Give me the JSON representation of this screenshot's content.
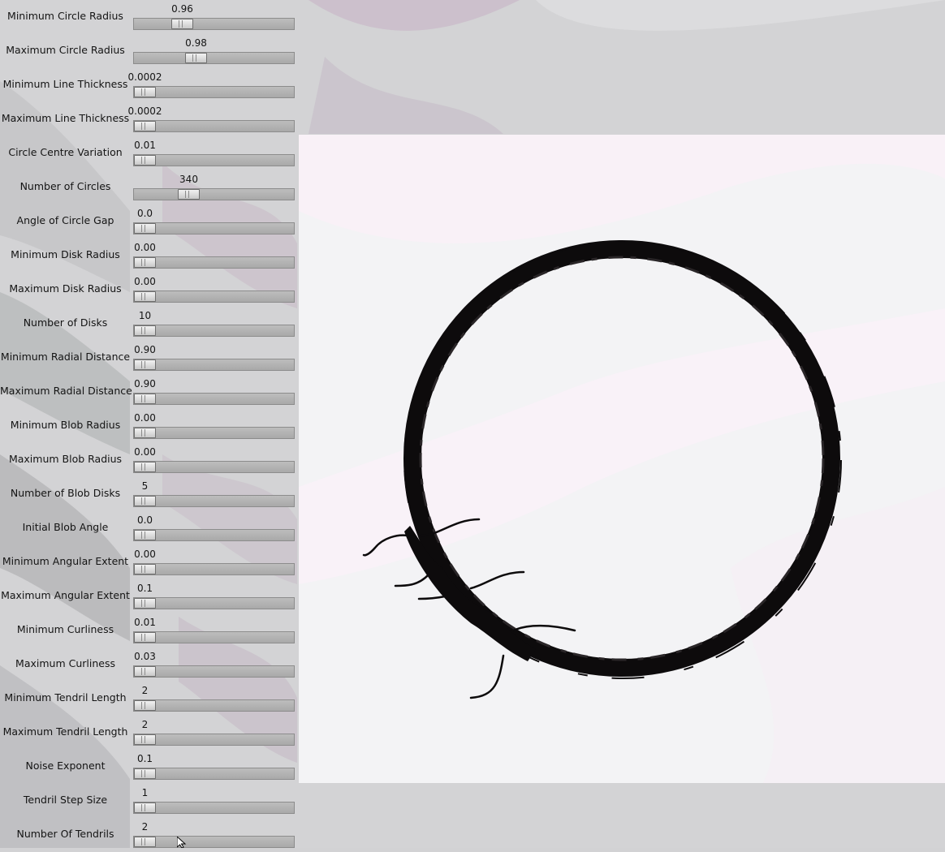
{
  "sliders": [
    {
      "label": "Minimum Circle Radius",
      "value": "0.96",
      "fraction": 0.27
    },
    {
      "label": "Maximum Circle Radius",
      "value": "0.98",
      "fraction": 0.37
    },
    {
      "label": "Minimum Line Thickness",
      "value": "0.0002",
      "fraction": 0.0
    },
    {
      "label": "Maximum Line Thickness",
      "value": "0.0002",
      "fraction": 0.0
    },
    {
      "label": "Circle Centre Variation",
      "value": "0.01",
      "fraction": 0.0
    },
    {
      "label": "Number of Circles",
      "value": "340",
      "fraction": 0.32
    },
    {
      "label": "Angle of Circle Gap",
      "value": "0.0",
      "fraction": 0.0
    },
    {
      "label": "Minimum Disk Radius",
      "value": "0.00",
      "fraction": 0.0
    },
    {
      "label": "Maximum Disk Radius",
      "value": "0.00",
      "fraction": 0.0
    },
    {
      "label": "Number of Disks",
      "value": "10",
      "fraction": 0.0
    },
    {
      "label": "Minimum Radial Distance",
      "value": "0.90",
      "fraction": 0.0
    },
    {
      "label": "Maximum Radial Distance",
      "value": "0.90",
      "fraction": 0.0
    },
    {
      "label": "Minimum Blob Radius",
      "value": "0.00",
      "fraction": 0.0
    },
    {
      "label": "Maximum Blob Radius",
      "value": "0.00",
      "fraction": 0.0
    },
    {
      "label": "Number of Blob Disks",
      "value": "5",
      "fraction": 0.0
    },
    {
      "label": "Initial Blob Angle",
      "value": "0.0",
      "fraction": 0.0
    },
    {
      "label": "Minimum Angular Extent",
      "value": "0.00",
      "fraction": 0.0
    },
    {
      "label": "Maximum Angular Extent",
      "value": "0.1",
      "fraction": 0.0
    },
    {
      "label": "Minimum Curliness",
      "value": "0.01",
      "fraction": 0.0
    },
    {
      "label": "Maximum Curliness",
      "value": "0.03",
      "fraction": 0.0
    },
    {
      "label": "Minimum Tendril Length",
      "value": "2",
      "fraction": 0.0
    },
    {
      "label": "Maximum Tendril Length",
      "value": "2",
      "fraction": 0.0
    },
    {
      "label": "Noise Exponent",
      "value": "0.1",
      "fraction": 0.0
    },
    {
      "label": "Tendril Step Size",
      "value": "1",
      "fraction": 0.0
    },
    {
      "label": "Number Of Tendrils",
      "value": "2",
      "fraction": 0.0
    }
  ],
  "colors": {
    "background": "#d2d2d4",
    "canvas": "#f3f3f5",
    "ink": "#0d0b0c",
    "track": "#b0b0b0",
    "thumb": "#e4e4e4"
  },
  "canvas": {
    "name": "ink-circle-drawing"
  }
}
